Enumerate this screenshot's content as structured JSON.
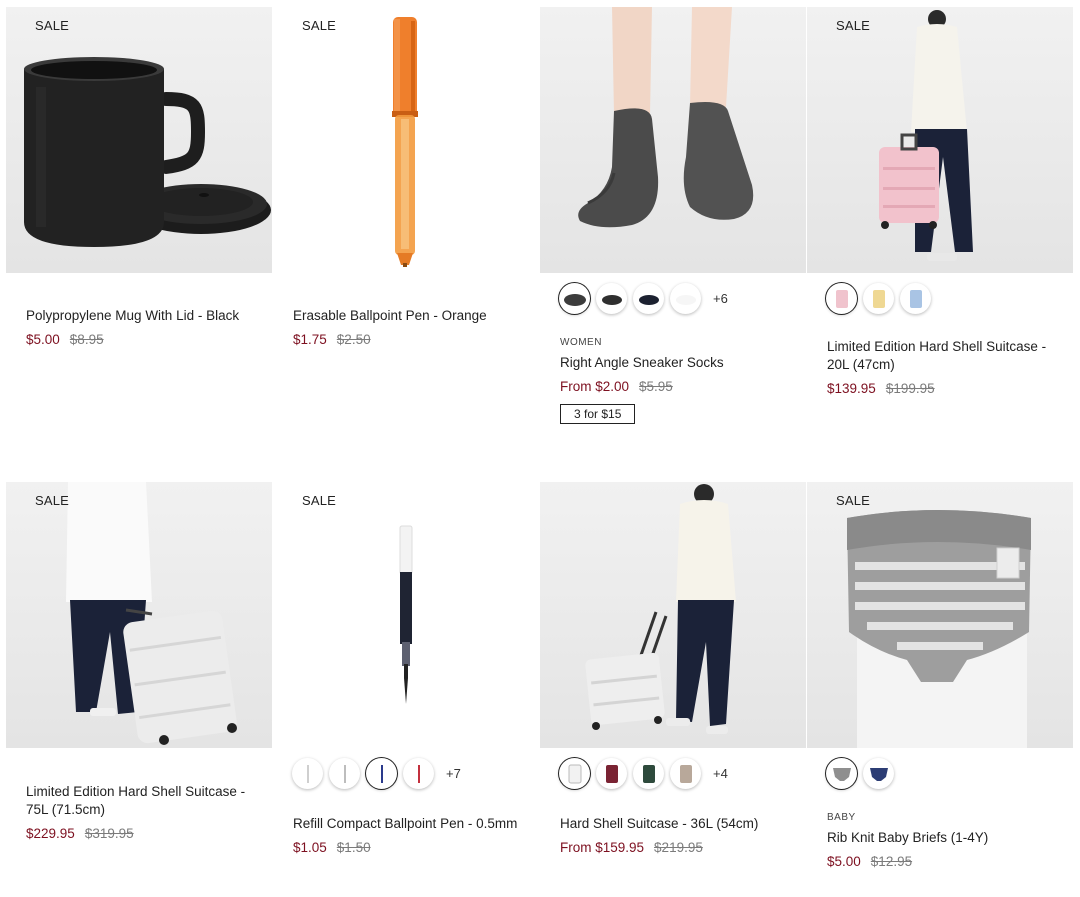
{
  "products": [
    {
      "name": "Polypropylene Mug With Lid - Black",
      "price": "$5.00",
      "original": "$8.95",
      "sale": "SALE",
      "image_icon": "mug-icon"
    },
    {
      "name": "Erasable Ballpoint Pen - Orange",
      "price": "$1.75",
      "original": "$2.50",
      "sale": "SALE",
      "image_icon": "pen-icon"
    },
    {
      "name": "Right Angle Sneaker Socks",
      "category": "WOMEN",
      "price": "From $2.00",
      "original": "$5.95",
      "promo": "3 for $15",
      "swatch_more": "+6",
      "image_icon": "socks-icon"
    },
    {
      "name": "Limited Edition Hard Shell Suitcase - 20L (47cm)",
      "price": "$139.95",
      "original": "$199.95",
      "sale": "SALE",
      "image_icon": "suitcase-icon"
    },
    {
      "name": "Limited Edition Hard Shell Suitcase - 75L (71.5cm)",
      "price": "$229.95",
      "original": "$319.95",
      "sale": "SALE",
      "image_icon": "suitcase-icon"
    },
    {
      "name": "Refill Compact Ballpoint Pen - 0.5mm",
      "price": "$1.05",
      "original": "$1.50",
      "sale": "SALE",
      "swatch_more": "+7",
      "image_icon": "pen-refill-icon"
    },
    {
      "name": "Hard Shell Suitcase - 36L (54cm)",
      "price": "From $159.95",
      "original": "$219.95",
      "swatch_more": "+4",
      "image_icon": "suitcase-icon"
    },
    {
      "name": "Rib Knit Baby Briefs (1-4Y)",
      "category": "BABY",
      "price": "$5.00",
      "original": "$12.95",
      "sale": "SALE",
      "image_icon": "briefs-icon"
    }
  ],
  "colors": {
    "sale_price": "#7d1020",
    "original_price": "#7b7b7b",
    "image_background": "#ececec"
  }
}
